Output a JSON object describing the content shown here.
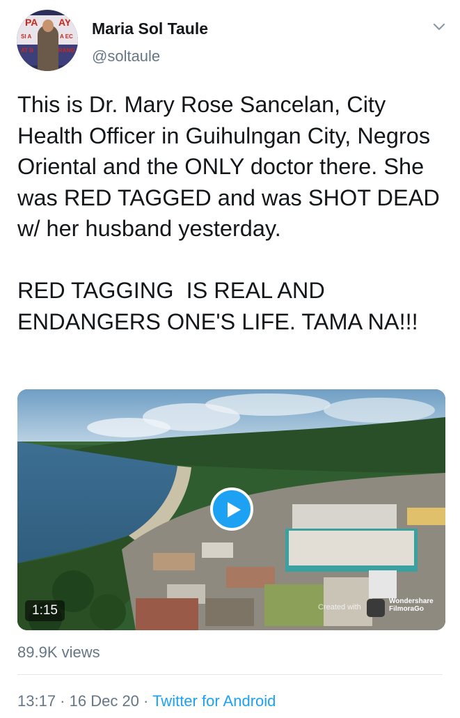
{
  "author": {
    "name": "Maria Sol Taule",
    "handle": "@soltaule",
    "avatar_sign_text": [
      "PA",
      "AY",
      "SI A",
      "A EC",
      "AT B",
      "RANG"
    ]
  },
  "tweet": {
    "text": "This is Dr. Mary Rose Sancelan, City Health Officer in Guihulngan City, Negros Oriental and the ONLY doctor there. She was RED TAGGED and was SHOT DEAD w/ her husband yesterday.\n\nRED TAGGING  IS REAL AND ENDANGERS ONE'S LIFE. TAMA NA!!!"
  },
  "video": {
    "duration": "1:15",
    "watermark_text": "Created with",
    "watermark_brand": [
      "Wondershare",
      "FilmoraGo"
    ]
  },
  "stats": {
    "views": "89.9K views"
  },
  "meta": {
    "time": "13:17",
    "separator": " · ",
    "date": "16 Dec 20",
    "source": "Twitter for Android"
  },
  "colors": {
    "accent": "#1da1f2",
    "text": "#14171a",
    "secondary": "#657786",
    "divider": "#e1e8ed"
  },
  "icons": [
    "chevron-down-icon",
    "play-icon"
  ]
}
